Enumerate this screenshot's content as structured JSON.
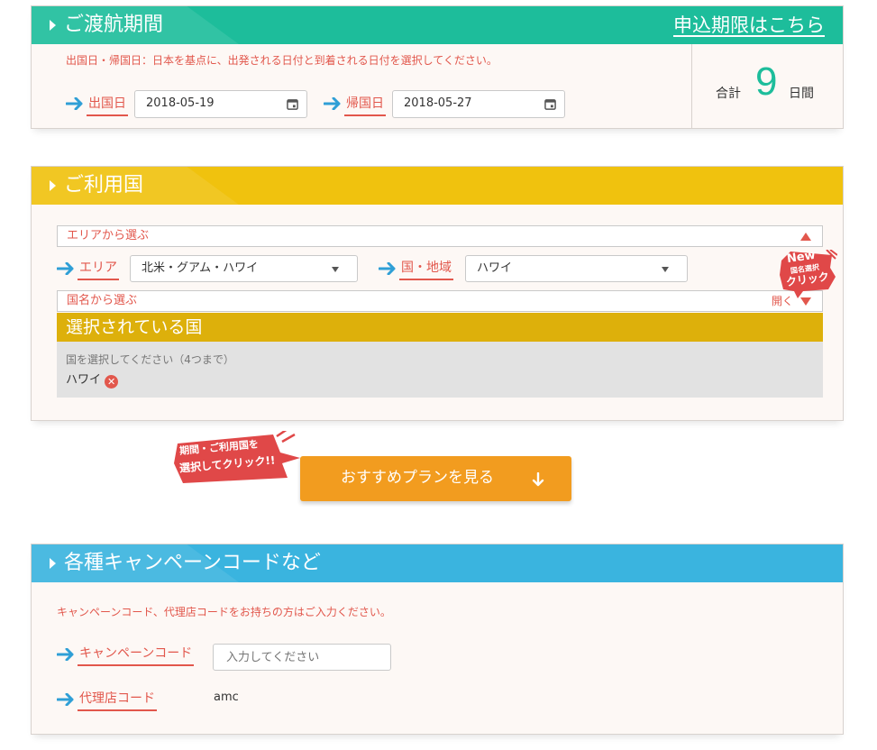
{
  "colors": {
    "period_header": "#1dbd9b",
    "country_header": "#f0c20e",
    "selected_bar": "#ddb00b",
    "campaign_header": "#3ab4df",
    "accent_red": "#e2574c",
    "arrow_blue": "#2f9fd6",
    "plan_button": "#f29c1f",
    "badge_red": "#e04848"
  },
  "period": {
    "title": "ご渡航期間",
    "deadline_link": "申込期限はこちら",
    "note": "出国日・帰国日：日本を基点に、出発される日付と到着される日付を選択してください。",
    "departure_label": "出国日",
    "departure_value": "2018-05-19",
    "return_label": "帰国日",
    "return_value": "2018-05-27",
    "total_prefix": "合計",
    "total_days": "9",
    "total_suffix": "日間",
    "icons": [
      "arrow-right-icon",
      "calendar-icon"
    ]
  },
  "countries": {
    "title": "ご利用国",
    "area_picker_label": "エリアから選ぶ",
    "area_label": "エリア",
    "area_value": "北米・グアム・ハワイ",
    "region_label": "国・地域",
    "region_value": "ハワイ",
    "name_picker_label": "国名から選ぶ",
    "open_label": "開く",
    "new_badge": {
      "line1": "New",
      "line2": "国名選択",
      "line3": "クリック"
    },
    "selected_title": "選択されている国",
    "selected_hint": "国を選択してください（4つまで）",
    "selected_items": [
      "ハワイ"
    ]
  },
  "plan": {
    "callout_line1": "期間・ご利用国を",
    "callout_line2": "選択してクリック!!",
    "button_label": "おすすめプランを見る"
  },
  "campaign": {
    "title": "各種キャンペーンコードなど",
    "note": "キャンペーンコード、代理店コードをお持ちの方はご入力ください。",
    "campaign_label": "キャンペーンコード",
    "campaign_placeholder": "入力してください",
    "agency_label": "代理店コード",
    "agency_value": "amc"
  }
}
